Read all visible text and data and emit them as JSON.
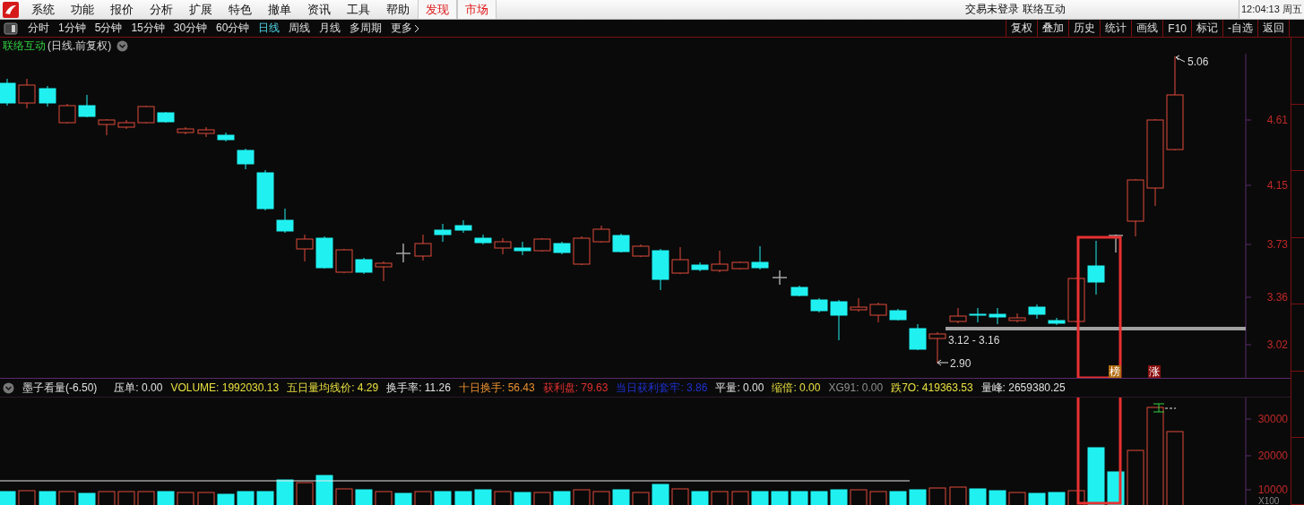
{
  "menu_bar": {
    "items": [
      {
        "label": "系统",
        "kind": "normal"
      },
      {
        "label": "功能",
        "kind": "normal"
      },
      {
        "label": "报价",
        "kind": "normal"
      },
      {
        "label": "分析",
        "kind": "normal"
      },
      {
        "label": "扩展",
        "kind": "normal"
      },
      {
        "label": "特色",
        "kind": "normal"
      },
      {
        "label": "撤单",
        "kind": "normal"
      },
      {
        "label": "资讯",
        "kind": "normal"
      },
      {
        "label": "工具",
        "kind": "normal"
      },
      {
        "label": "帮助",
        "kind": "normal"
      },
      {
        "label": "发现",
        "kind": "featured"
      },
      {
        "label": "市场",
        "kind": "featured"
      }
    ],
    "status": "交易未登录  联络互动",
    "clock": "12:04:13 周五"
  },
  "toolbar": {
    "periods": [
      {
        "label": "分时",
        "selected": false
      },
      {
        "label": "1分钟",
        "selected": false
      },
      {
        "label": "5分钟",
        "selected": false
      },
      {
        "label": "15分钟",
        "selected": false
      },
      {
        "label": "30分钟",
        "selected": false
      },
      {
        "label": "60分钟",
        "selected": false
      },
      {
        "label": "日线",
        "selected": true
      },
      {
        "label": "周线",
        "selected": false
      },
      {
        "label": "月线",
        "selected": false
      },
      {
        "label": "多周期",
        "selected": false
      }
    ],
    "more": "更多",
    "actions": [
      "复权",
      "叠加",
      "历史",
      "统计",
      "画线",
      "F10",
      "标记",
      "-自选",
      "返回"
    ]
  },
  "price_chart": {
    "stock_name": "联络互动",
    "mode": "(日线.前复权)",
    "axis_labels": [
      "4.61",
      "4.15",
      "3.73",
      "3.36",
      "3.02"
    ],
    "annotations": {
      "high": "5.06",
      "range": "3.12 - 3.16",
      "low": "2.90"
    },
    "badges": [
      {
        "label": "榜",
        "color": "#b06a10"
      },
      {
        "label": "涨",
        "color": "#8a1010"
      }
    ]
  },
  "indicator": {
    "name": "墨子看量(-6.50)",
    "items": [
      {
        "text": "压单: 0.00",
        "kind": "plain"
      },
      {
        "text": "VOLUME: 1992030.13",
        "kind": "volume"
      },
      {
        "text": "五日量均线价: 4.29",
        "kind": "volume"
      },
      {
        "text": "换手率: 11.26",
        "kind": "plain"
      },
      {
        "text": "十日换手: 56.43",
        "kind": "turnover"
      },
      {
        "text": "获利盘: 79.63",
        "kind": "profit"
      },
      {
        "text": "当日获利套牢: 3.86",
        "kind": "trapped"
      },
      {
        "text": "平量: 0.00",
        "kind": "plain"
      },
      {
        "text": "缩倍: 0.00",
        "kind": "volume"
      },
      {
        "text": "XG91: 0.00",
        "kind": "muted"
      },
      {
        "text": "跌7O: 419363.53",
        "kind": "volume"
      },
      {
        "text": "量峰: 2659380.25",
        "kind": "plain"
      }
    ]
  },
  "volume_chart": {
    "axis_labels": [
      "30000",
      "20000",
      "10000"
    ],
    "unit": "X100"
  }
}
